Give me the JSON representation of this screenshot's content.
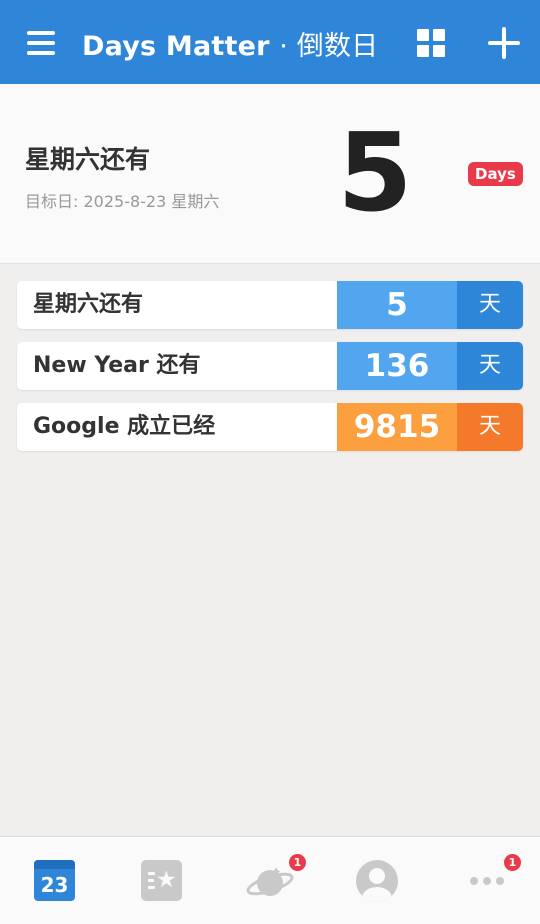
{
  "header": {
    "title": "Days Matter",
    "subtitle": "· 倒数日",
    "menu_icon": "hamburger-menu-icon",
    "grid_icon": "grid-view-icon",
    "add_icon": "plus-icon"
  },
  "featured": {
    "title": "星期六还有",
    "target_date": "目标日: 2025-8-23 星期六",
    "count": "5",
    "unit_badge": "Days"
  },
  "events": [
    {
      "label": "星期六还有",
      "count": "5",
      "unit": "天",
      "color": "blue"
    },
    {
      "label": "New Year 还有",
      "count": "136",
      "unit": "天",
      "color": "blue"
    },
    {
      "label": "Google 成立已经",
      "count": "9815",
      "unit": "天",
      "color": "orange"
    }
  ],
  "colors": {
    "primary": "#2f85d8",
    "blue_count": "#52a6f0",
    "blue_unit": "#2e86d8",
    "orange_count": "#fb9f3f",
    "orange_unit": "#f4792a",
    "badge_red": "#e93a4a"
  },
  "bottom_nav": {
    "calendar_day": "23",
    "discover_badge": "1",
    "more_badge": "1",
    "items": [
      "calendar-icon",
      "starred-list-icon",
      "planet-icon",
      "avatar-icon",
      "more-icon"
    ]
  }
}
